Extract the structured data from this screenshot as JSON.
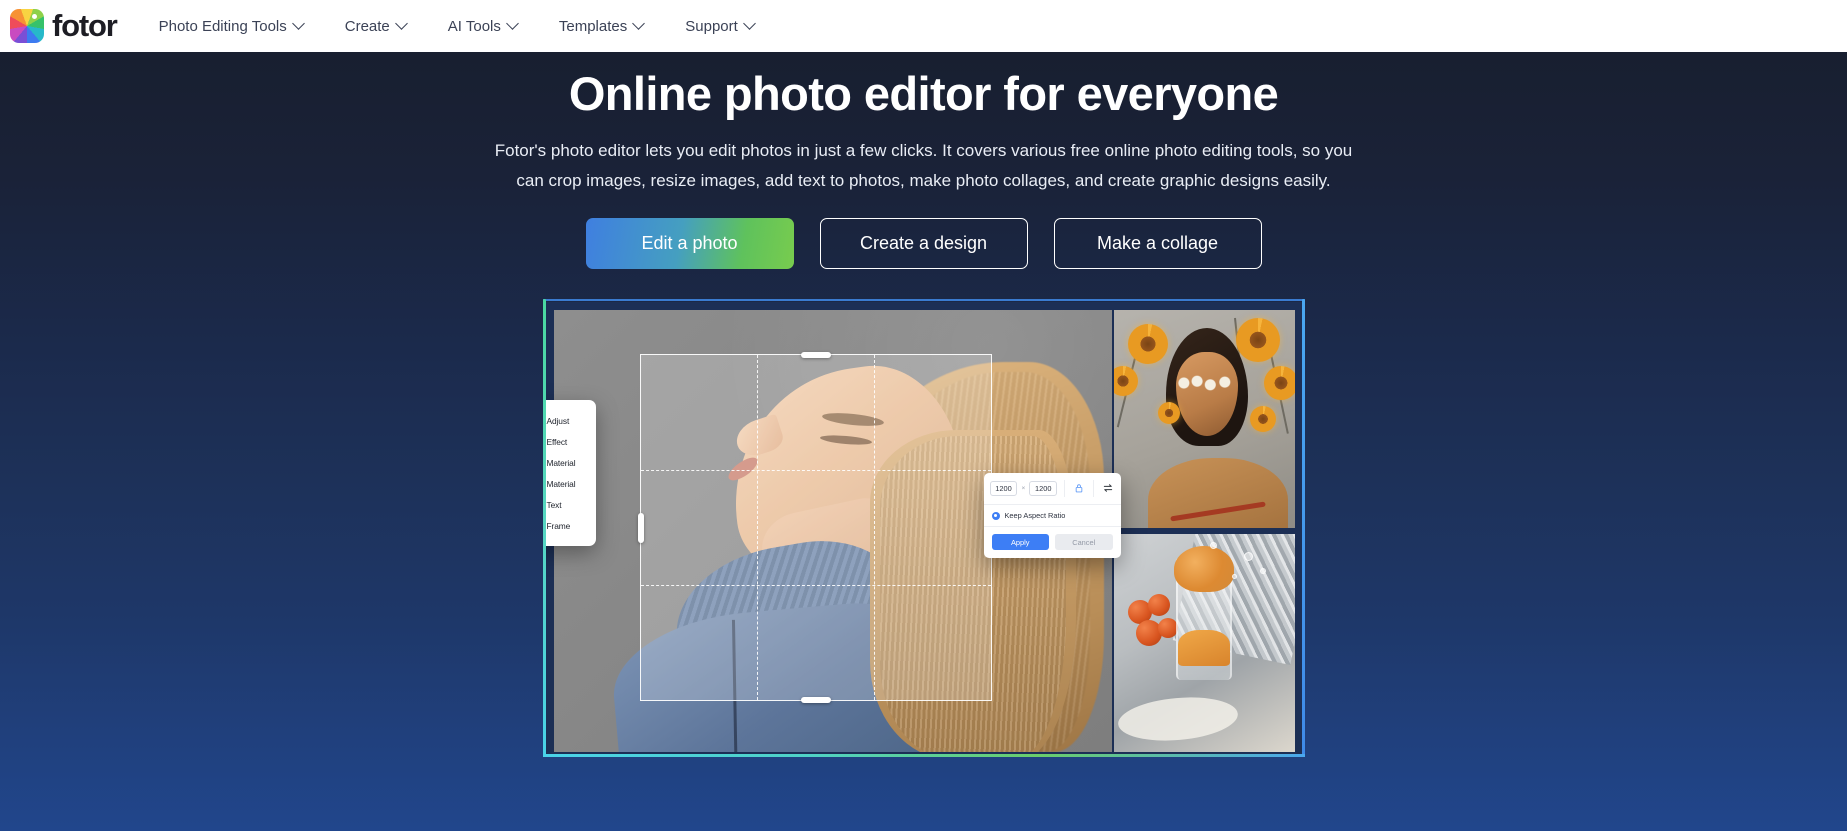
{
  "nav": {
    "brand_name": "fotor",
    "brand_icon": "color-wheel-logo-icon",
    "items": [
      {
        "label": "Photo Editing Tools",
        "icon": "chevron-down-icon"
      },
      {
        "label": "Create",
        "icon": "chevron-down-icon"
      },
      {
        "label": "AI Tools",
        "icon": "chevron-down-icon"
      },
      {
        "label": "Templates",
        "icon": "chevron-down-icon"
      },
      {
        "label": "Support",
        "icon": "chevron-down-icon"
      }
    ]
  },
  "hero": {
    "title": "Online photo editor for everyone",
    "subtitle": "Fotor's photo editor lets you edit photos in just a few clicks. It covers various free online photo editing tools, so you can crop images, resize images, add text to photos, make photo collages, and create graphic designs easily.",
    "buttons": [
      {
        "label": "Edit a photo",
        "style": "gradient-primary"
      },
      {
        "label": "Create a design",
        "style": "outline"
      },
      {
        "label": "Make a collage",
        "style": "outline"
      }
    ]
  },
  "mockup": {
    "tool_panel": {
      "items": [
        {
          "label": "Adjust",
          "icon": "sliders-icon"
        },
        {
          "label": "Effect",
          "icon": "flask-icon"
        },
        {
          "label": "Material",
          "icon": "eye-icon"
        },
        {
          "label": "Material",
          "icon": "flower-icon"
        },
        {
          "label": "Text",
          "icon": "text-t-icon"
        },
        {
          "label": "Frame",
          "icon": "frame-icon"
        }
      ]
    },
    "resize_dialog": {
      "width_value": "1200",
      "height_value": "1200",
      "multiply_symbol": "×",
      "lock_icon": "lock-icon",
      "swap_icon": "swap-arrows-icon",
      "keep_aspect_label": "Keep Aspect Ratio",
      "keep_aspect_checked": true,
      "apply_label": "Apply",
      "cancel_label": "Cancel"
    },
    "canvas": {
      "subject": "woman-portrait-blonde-hair-blue-turtleneck",
      "crop_overlay": true
    },
    "collage": [
      {
        "subject": "woman-with-sunflowers-and-floral-mask"
      },
      {
        "subject": "orange-dessert-in-glass-with-fruit"
      }
    ]
  },
  "colors": {
    "hero_gradient_top": "#181f30",
    "hero_gradient_bottom": "#21468c",
    "cta_gradient_from": "#3f7fe0",
    "cta_gradient_to": "#78cc4e",
    "accent_blue": "#3d7ef5",
    "nav_text": "#3b4256",
    "white": "#ffffff"
  }
}
